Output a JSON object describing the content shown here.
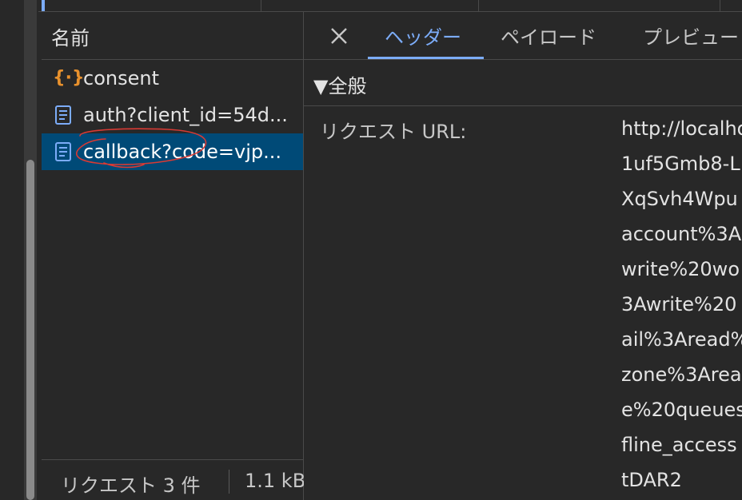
{
  "colors": {
    "background": "#282828",
    "selected_row": "#004a77",
    "accent": "#7cacf8",
    "json_icon": "#e8912d",
    "annotation": "#d83a34"
  },
  "name_panel": {
    "header": "名前",
    "requests": [
      {
        "icon": "json-braces-icon",
        "name": "consent",
        "selected": false
      },
      {
        "icon": "document-icon",
        "name": "auth?client_id=54d...",
        "selected": false
      },
      {
        "icon": "document-icon",
        "name": "callback?code=vjp...",
        "selected": true
      }
    ],
    "status": {
      "count": "リクエスト 3 件",
      "size": "1.1 kB"
    }
  },
  "detail_panel": {
    "tabs": [
      {
        "label": "ヘッダー",
        "active": true
      },
      {
        "label": "ペイロード",
        "active": false
      },
      {
        "label": "プレビュー",
        "active": false
      }
    ],
    "section": "▼全般",
    "request_url_label": "リクエスト URL:",
    "request_url_lines": [
      "http://localhost",
      "1uf5Gmb8-L",
      "XqSvh4Wpu",
      "account%3A",
      "write%20wo",
      "3Awrite%20",
      "ail%3Aread%",
      "zone%3Area",
      "e%20queues",
      "fline_access",
      "tDAR2"
    ]
  }
}
